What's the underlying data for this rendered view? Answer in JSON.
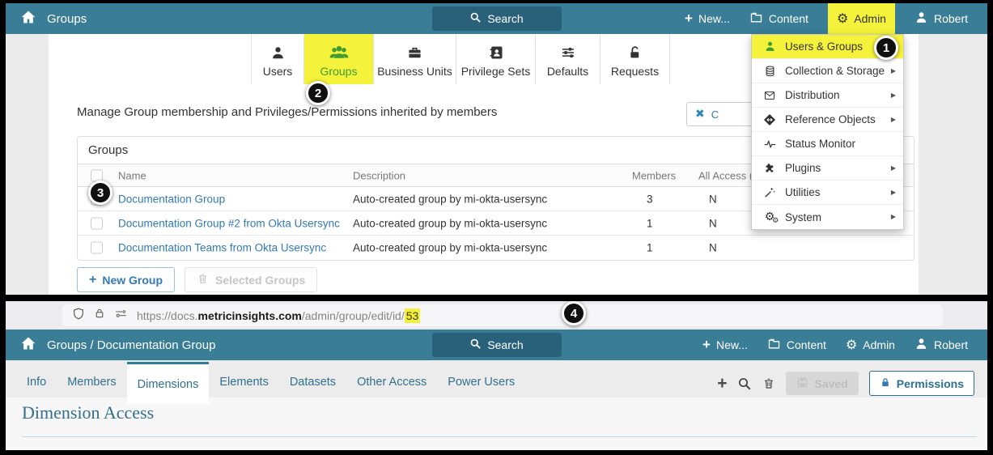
{
  "colors": {
    "navbar_teal": "#3a7d96",
    "search_button": "#29607a",
    "highlight_yellow": "#f4f23b",
    "green_accent": "#3f9c35",
    "link_blue": "#337ab7",
    "teal_text": "#31708f"
  },
  "callouts": {
    "one": "1",
    "two": "2",
    "three": "3",
    "four": "4"
  },
  "s1": {
    "nav": {
      "title": "Groups",
      "search": "Search",
      "new_label": "New...",
      "content": "Content",
      "admin": "Admin",
      "user": "Robert"
    },
    "tabs": [
      {
        "label": "Users"
      },
      {
        "label": "Groups"
      },
      {
        "label": "Business Units"
      },
      {
        "label": "Privilege Sets"
      },
      {
        "label": "Defaults"
      },
      {
        "label": "Requests"
      }
    ],
    "manage_text": "Manage Group membership and Privileges/Permissions inherited by members",
    "close_label": "C",
    "panel": {
      "title": "Groups",
      "col_name": "Name",
      "col_desc": "Description",
      "col_members": "Members",
      "col_all_access": "All Access (",
      "rows": [
        {
          "name": "Documentation Group",
          "desc": "Auto-created group by mi-okta-usersync",
          "members": "3",
          "all_access": "N"
        },
        {
          "name": "Documentation Group #2 from Okta Usersync",
          "desc": "Auto-created group by mi-okta-usersync",
          "members": "1",
          "all_access": "N"
        },
        {
          "name": "Documentation Teams from Okta Usersync",
          "desc": "Auto-created group by mi-okta-usersync",
          "members": "1",
          "all_access": "N"
        }
      ]
    },
    "new_group": "New Group",
    "selected_groups": "Selected Groups",
    "menu": {
      "items": [
        {
          "label": "Users & Groups"
        },
        {
          "label": "Collection & Storage"
        },
        {
          "label": "Distribution"
        },
        {
          "label": "Reference Objects"
        },
        {
          "label": "Status Monitor"
        },
        {
          "label": "Plugins"
        },
        {
          "label": "Utilities"
        },
        {
          "label": "System"
        }
      ]
    }
  },
  "url": {
    "prefix": "https://",
    "sub": "docs.",
    "domain": "metricinsights.com",
    "path": "/admin/group/edit/id/",
    "id": "53"
  },
  "s2": {
    "nav": {
      "title": "Groups / Documentation Group",
      "search": "Search",
      "new_label": "New...",
      "content": "Content",
      "admin": "Admin",
      "user": "Robert"
    },
    "tabs": [
      {
        "label": "Info"
      },
      {
        "label": "Members"
      },
      {
        "label": "Dimensions"
      },
      {
        "label": "Elements"
      },
      {
        "label": "Datasets"
      },
      {
        "label": "Other Access"
      },
      {
        "label": "Power Users"
      }
    ],
    "saved": "Saved",
    "permissions": "Permissions",
    "heading": "Dimension Access"
  }
}
